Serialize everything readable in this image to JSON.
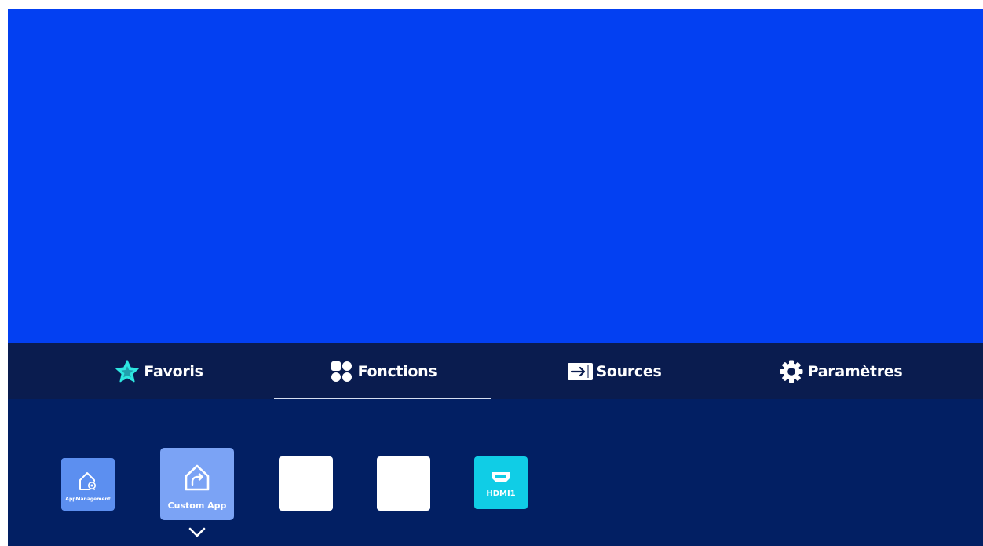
{
  "tabs": [
    {
      "label": "Favoris",
      "icon": "star-icon"
    },
    {
      "label": "Fonctions",
      "icon": "grid-icon",
      "active": true
    },
    {
      "label": "Sources",
      "icon": "input-source-icon"
    },
    {
      "label": "Paramètres",
      "icon": "gear-icon"
    }
  ],
  "tiles": {
    "app_management": {
      "label": "AppManagement",
      "icon": "home-gear-icon"
    },
    "custom_app": {
      "label": "Custom App",
      "icon": "home-share-icon"
    },
    "hdmi1": {
      "label": "HDMI1",
      "icon": "hdmi-icon"
    }
  },
  "colors": {
    "screen_background": "#0340f2",
    "tab_bar": "#0a1c4f",
    "tray": "#021f63",
    "tile_app": "#5c8ff0",
    "tile_focused": "#7ba3f5",
    "tile_hdmi": "#10cde6",
    "star_accent": "#2ee6e0"
  }
}
